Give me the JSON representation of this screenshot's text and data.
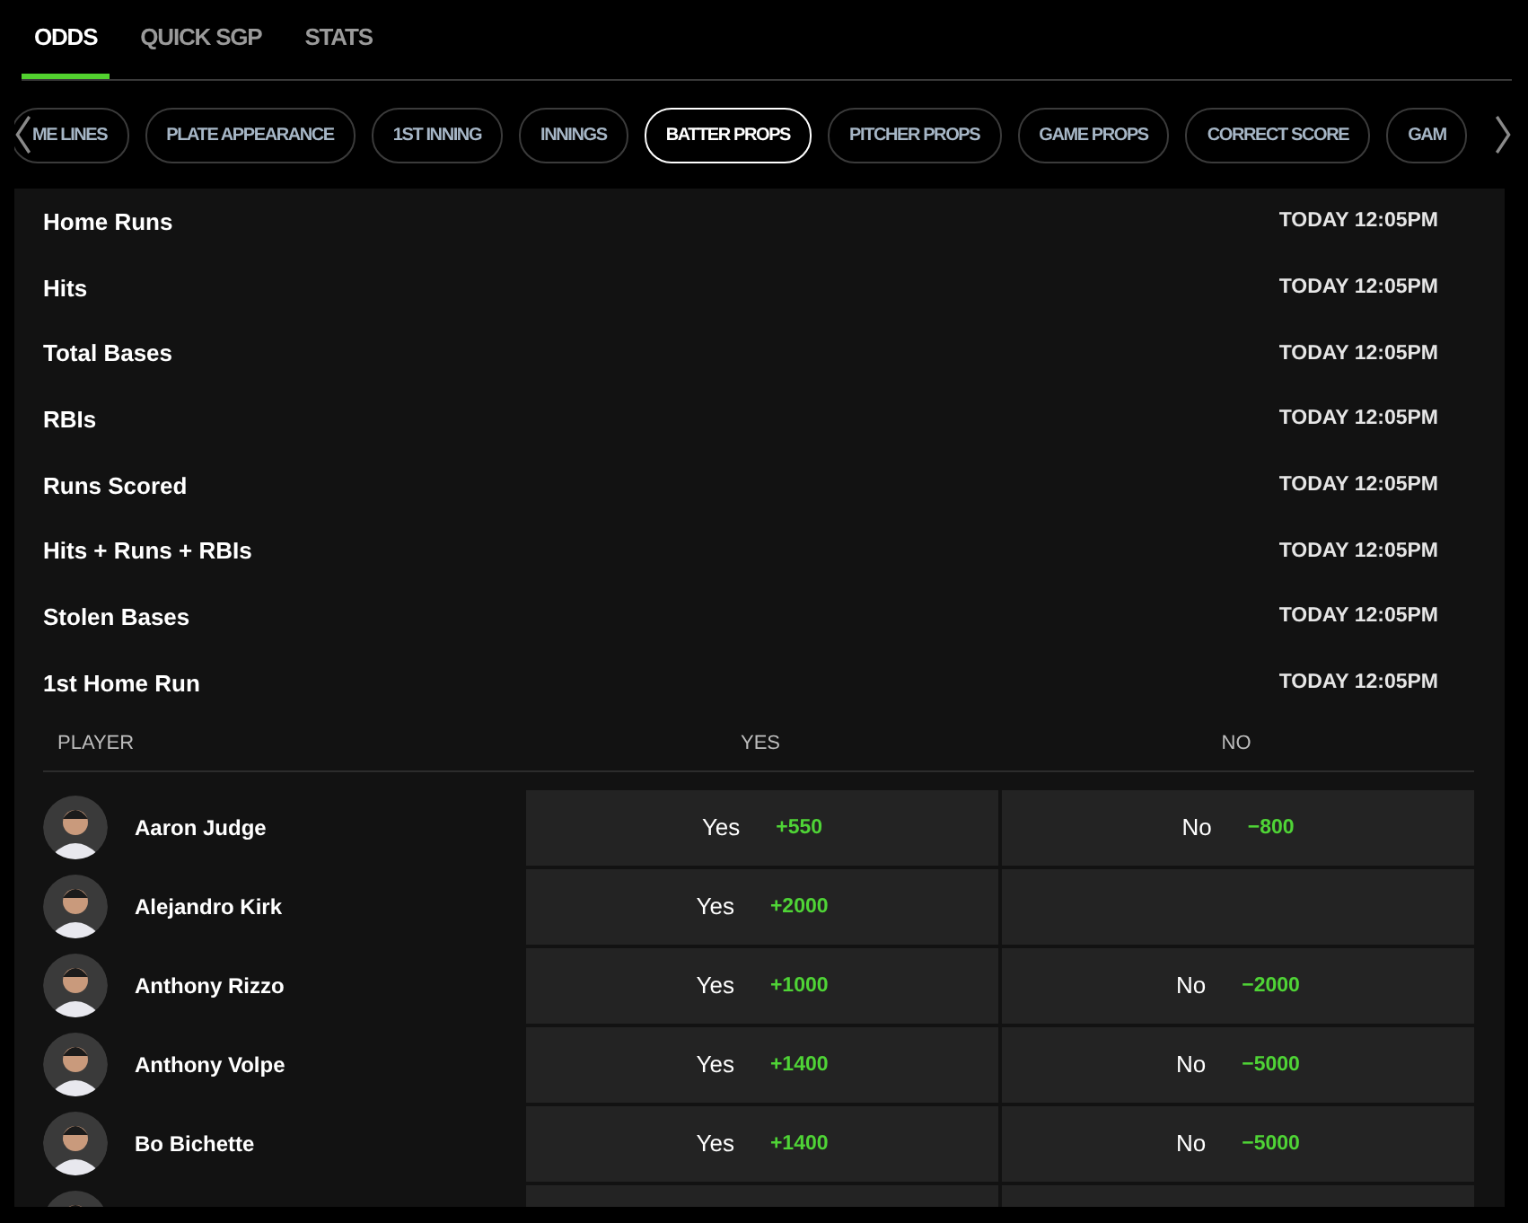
{
  "tabs": [
    {
      "label": "ODDS",
      "selected": true
    },
    {
      "label": "QUICK SGP",
      "selected": false
    },
    {
      "label": "STATS",
      "selected": false
    }
  ],
  "categories": [
    {
      "label": "ME LINES",
      "selected": false
    },
    {
      "label": "PLATE APPEARANCE",
      "selected": false
    },
    {
      "label": "1ST INNING",
      "selected": false
    },
    {
      "label": "INNINGS",
      "selected": false
    },
    {
      "label": "BATTER PROPS",
      "selected": true
    },
    {
      "label": "PITCHER PROPS",
      "selected": false
    },
    {
      "label": "GAME PROPS",
      "selected": false
    },
    {
      "label": "CORRECT SCORE",
      "selected": false
    },
    {
      "label": "GAM",
      "selected": false
    }
  ],
  "markets": [
    {
      "name": "Home Runs",
      "time": "TODAY 12:05PM"
    },
    {
      "name": "Hits",
      "time": "TODAY 12:05PM"
    },
    {
      "name": "Total Bases",
      "time": "TODAY 12:05PM"
    },
    {
      "name": "RBIs",
      "time": "TODAY 12:05PM"
    },
    {
      "name": "Runs Scored",
      "time": "TODAY 12:05PM"
    },
    {
      "name": "Hits + Runs + RBIs",
      "time": "TODAY 12:05PM"
    },
    {
      "name": "Stolen Bases",
      "time": "TODAY 12:05PM"
    },
    {
      "name": "1st Home Run",
      "time": "TODAY 12:05PM"
    }
  ],
  "table": {
    "columns": [
      "PLAYER",
      "YES",
      "NO"
    ],
    "rows": [
      {
        "kind": "player",
        "name": "Aaron Judge",
        "yes": {
          "label": "Yes",
          "odds": "+550"
        },
        "no": {
          "label": "No",
          "odds": "−800"
        }
      },
      {
        "kind": "player",
        "name": "Alejandro Kirk",
        "yes": {
          "label": "Yes",
          "odds": "+2000"
        }
      },
      {
        "kind": "player",
        "name": "Anthony Rizzo",
        "yes": {
          "label": "Yes",
          "odds": "+1000"
        },
        "no": {
          "label": "No",
          "odds": "−2000"
        }
      },
      {
        "kind": "player",
        "name": "Anthony Volpe",
        "yes": {
          "label": "Yes",
          "odds": "+1400"
        },
        "no": {
          "label": "No",
          "odds": "−5000"
        }
      },
      {
        "kind": "player",
        "name": "Bo Bichette",
        "yes": {
          "label": "Yes",
          "odds": "+1400"
        },
        "no": {
          "label": "No",
          "odds": "−5000"
        }
      },
      {
        "kind": "partial"
      }
    ]
  }
}
